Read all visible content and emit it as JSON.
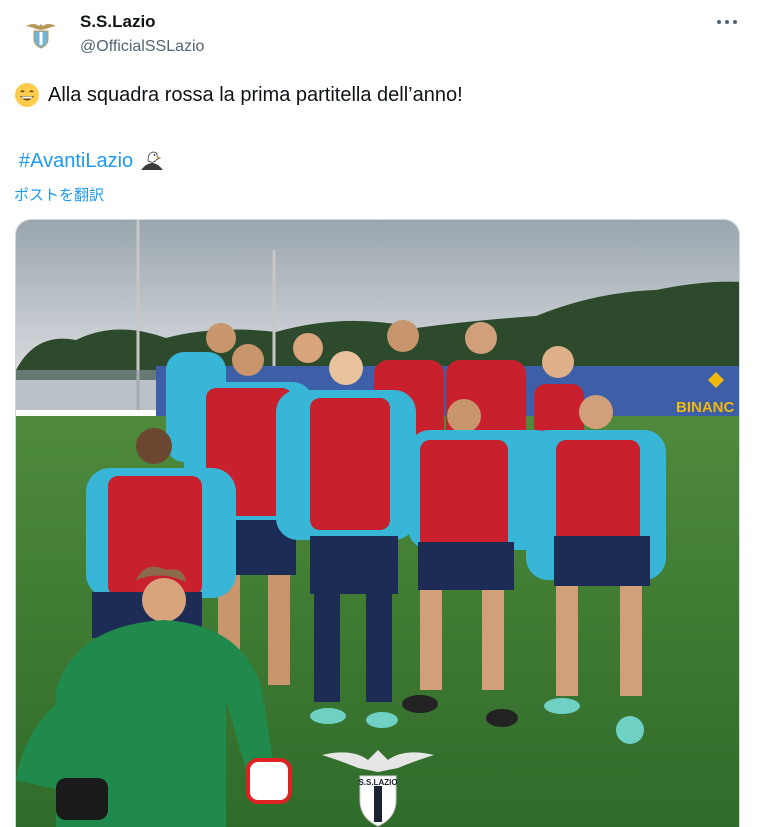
{
  "author": {
    "name": "S.S.Lazio",
    "handle": "@OfficialSSLazio",
    "avatar_icon": "eagle-crest-icon"
  },
  "menu": {
    "icon": "more-options-icon"
  },
  "tweet": {
    "text": "Alla squadra rossa la prima partitella dell’anno!",
    "leading_emoji": "grinning-face-icon",
    "hashtag": "#AvantiLazio",
    "hashtag_emoji": "eagle-icon",
    "translate_label": "ポストを翻訳"
  },
  "media": {
    "banner_text": "BINANC",
    "crest_text": "S.S.LAZIO"
  },
  "colors": {
    "link": "#1d9bf0",
    "text": "#0f1419",
    "secondary": "#536471",
    "bib_red": "#c8202c",
    "kit_sky": "#38b6d8",
    "keeper_green": "#1f8a4c"
  }
}
